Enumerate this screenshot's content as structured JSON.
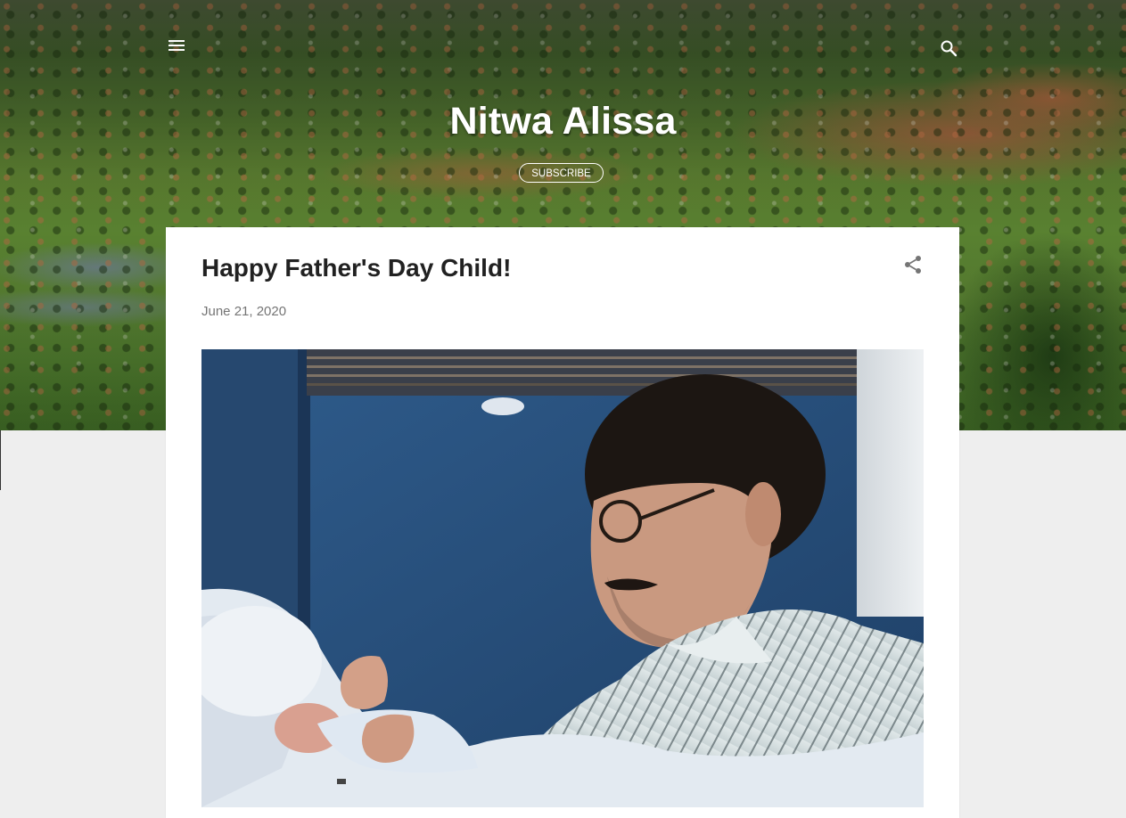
{
  "header": {
    "site_title": "Nitwa Alissa",
    "subscribe_label": "SUBSCRIBE",
    "menu_icon": "hamburger-menu-icon",
    "search_icon": "search-icon"
  },
  "post": {
    "title": "Happy Father's Day Child!",
    "date": "June 21, 2020",
    "share_icon": "share-icon"
  },
  "colors": {
    "background": "#eeeeee",
    "card": "#ffffff",
    "title_text": "#212121",
    "date_text": "#757575",
    "header_text": "#ffffff"
  }
}
